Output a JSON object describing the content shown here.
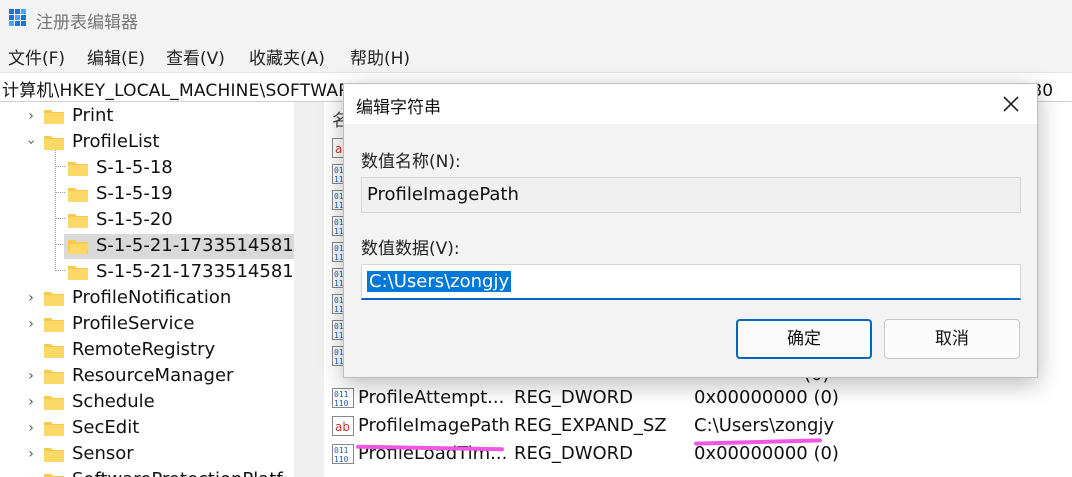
{
  "window": {
    "title": "注册表编辑器"
  },
  "menu": [
    "文件(F)",
    "编辑(E)",
    "查看(V)",
    "收藏夹(A)",
    "帮助(H)"
  ],
  "address": "计算机\\HKEY_LOCAL_MACHINE\\SOFTWARE\\Microsoft\\Windows NT\\CurrentVersion\\ProfileList\\S-1-5-21-1733514581-317980",
  "tree": {
    "items": [
      {
        "label": "Print",
        "expand": "collapsed"
      },
      {
        "label": "ProfileList",
        "expand": "expanded"
      },
      {
        "label": "S-1-5-18",
        "expand": "none"
      },
      {
        "label": "S-1-5-19",
        "expand": "none"
      },
      {
        "label": "S-1-5-20",
        "expand": "none"
      },
      {
        "label": "S-1-5-21-1733514581",
        "expand": "none",
        "selected": true
      },
      {
        "label": "S-1-5-21-1733514581",
        "expand": "none"
      },
      {
        "label": "ProfileNotification",
        "expand": "collapsed"
      },
      {
        "label": "ProfileService",
        "expand": "collapsed"
      },
      {
        "label": "RemoteRegistry",
        "expand": "none"
      },
      {
        "label": "ResourceManager",
        "expand": "collapsed"
      },
      {
        "label": "Schedule",
        "expand": "collapsed"
      },
      {
        "label": "SecEdit",
        "expand": "collapsed"
      },
      {
        "label": "Sensor",
        "expand": "collapsed"
      },
      {
        "label": "SoftwareProtectionPlatf",
        "expand": "collapsed"
      }
    ]
  },
  "values": {
    "header_name": "名",
    "rows": [
      {
        "name": "ProfileAttempt...",
        "type": "REG_DWORD",
        "data": "0x00000000 (0)",
        "icon": "binary-icon"
      },
      {
        "name": "ProfileImagePath",
        "type": "REG_EXPAND_SZ",
        "data": "C:\\Users\\zongjy",
        "icon": "string-icon"
      },
      {
        "name": "ProfileLoadTim...",
        "type": "REG_DWORD",
        "data": "0x00000000 (0)",
        "icon": "binary-icon"
      }
    ],
    "partial_data": "(0)"
  },
  "dialog": {
    "title": "编辑字符串",
    "name_label": "数值名称(N):",
    "name_value": "ProfileImagePath",
    "data_label": "数值数据(V):",
    "data_value": "C:\\Users\\zongjy",
    "ok_label": "确定",
    "cancel_label": "取消"
  },
  "colors": {
    "selection": "#0078d7",
    "annotation": "#f257e3",
    "folder": "#f8c94b"
  }
}
